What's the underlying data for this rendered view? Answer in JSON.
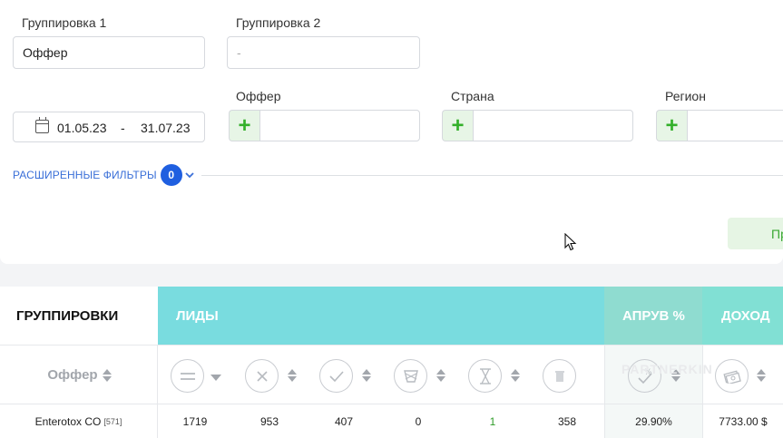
{
  "filters": {
    "grouping1": {
      "label": "Группировка 1",
      "value": "Оффер"
    },
    "grouping2": {
      "label": "Группировка 2",
      "placeholder": "-"
    },
    "date": {
      "from": "01.05.23",
      "separator": "-",
      "to": "31.07.23"
    },
    "offer": {
      "label": "Оффер"
    },
    "country": {
      "label": "Страна"
    },
    "region": {
      "label": "Регион"
    },
    "advanced": {
      "label": "РАСШИРЕННЫЕ ФИЛЬТРЫ",
      "count": "0"
    },
    "apply_label": "Пр",
    "plus_symbol": "+",
    "accent_color": "#1f5fe0",
    "plus_color": "#33b02a"
  },
  "table": {
    "headers": {
      "groupings": "ГРУППИРОВКИ",
      "leads": "ЛИДЫ",
      "approve": "АПРУВ %",
      "income": "ДОХОД"
    },
    "sub_header_offer": "Оффер",
    "lead_icons": [
      "equals-icon",
      "cross-icon",
      "check-icon",
      "trash-box-icon",
      "hourglass-icon",
      "delete-icon"
    ],
    "approve_icon": "percent-check-icon",
    "income_icon": "money-icon",
    "watermark": "PARTNERKIN",
    "rows": [
      {
        "offer": "Enterotox CO",
        "offer_id": "[571]",
        "total": "1719",
        "rejected": "953",
        "approved": "407",
        "trash": "0",
        "hold": "1",
        "deleted": "358",
        "approve_pct": "29.90%",
        "income": "7733.00 $"
      }
    ]
  }
}
